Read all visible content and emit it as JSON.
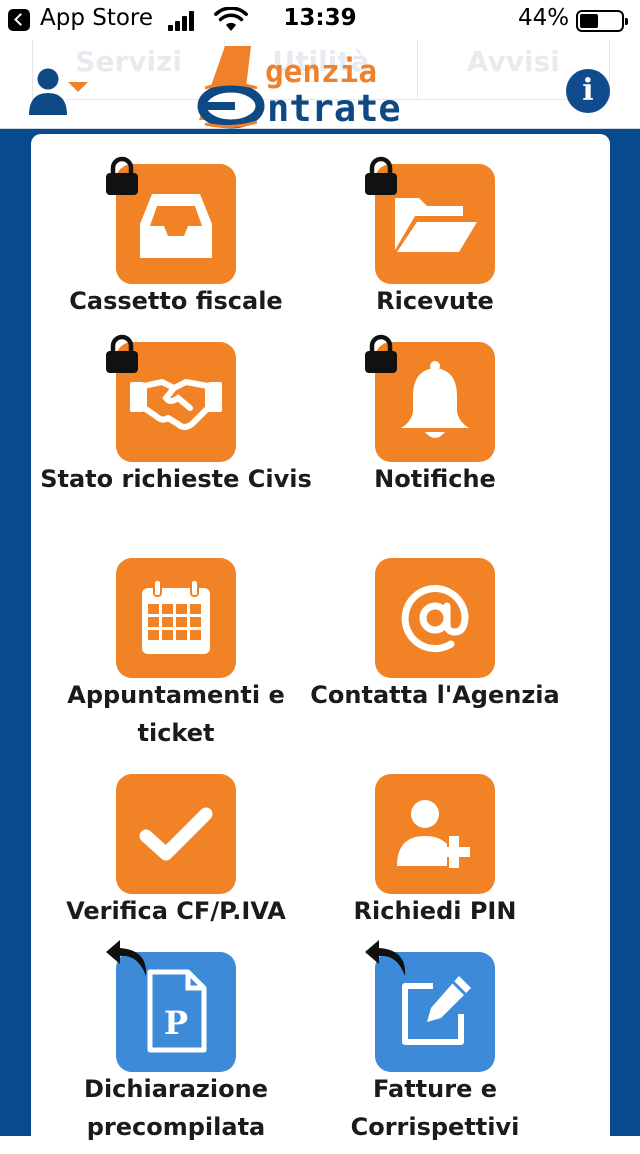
{
  "status_bar": {
    "back_label": "App Store",
    "time": "13:39",
    "battery_percent_text": "44%",
    "battery_level": 0.44
  },
  "header": {
    "ghost_tabs": [
      "Servizi",
      "Utilità",
      "Avvisi"
    ],
    "logo_line1": "genzia",
    "logo_line2": "ntrate",
    "logo_letters": "AE",
    "user_icon": "user-dropdown-icon",
    "info_icon": "info-icon"
  },
  "colors": {
    "brand_blue": "#074a8e",
    "tile_orange": "#f18326",
    "tile_blue": "#3d8bd8"
  },
  "tiles": [
    {
      "label": "Cassetto fiscale",
      "icon": "inbox-tray-icon",
      "color": "orange",
      "badge": "lock"
    },
    {
      "label": "Ricevute",
      "icon": "folder-open-icon",
      "color": "orange",
      "badge": "lock"
    },
    {
      "label": "Stato richieste Civis",
      "icon": "handshake-icon",
      "color": "orange",
      "badge": "lock"
    },
    {
      "label": "Notifiche",
      "icon": "bell-icon",
      "color": "orange",
      "badge": "lock"
    },
    {
      "label": "Appuntamenti e ticket",
      "icon": "calendar-icon",
      "color": "orange",
      "badge": "none"
    },
    {
      "label": "Contatta l'Agenzia",
      "icon": "at-sign-icon",
      "color": "orange",
      "badge": "none"
    },
    {
      "label": "Verifica CF/P.IVA",
      "icon": "checkmark-icon",
      "color": "orange",
      "badge": "none"
    },
    {
      "label": "Richiedi PIN",
      "icon": "add-user-icon",
      "color": "orange",
      "badge": "none"
    },
    {
      "label": "Dichiarazione precompilata",
      "icon": "document-p-icon",
      "color": "blue",
      "badge": "external-link-arrow"
    },
    {
      "label": "Fatture e Corrispettivi",
      "icon": "edit-pencil-icon",
      "color": "blue",
      "badge": "external-link-arrow"
    }
  ]
}
